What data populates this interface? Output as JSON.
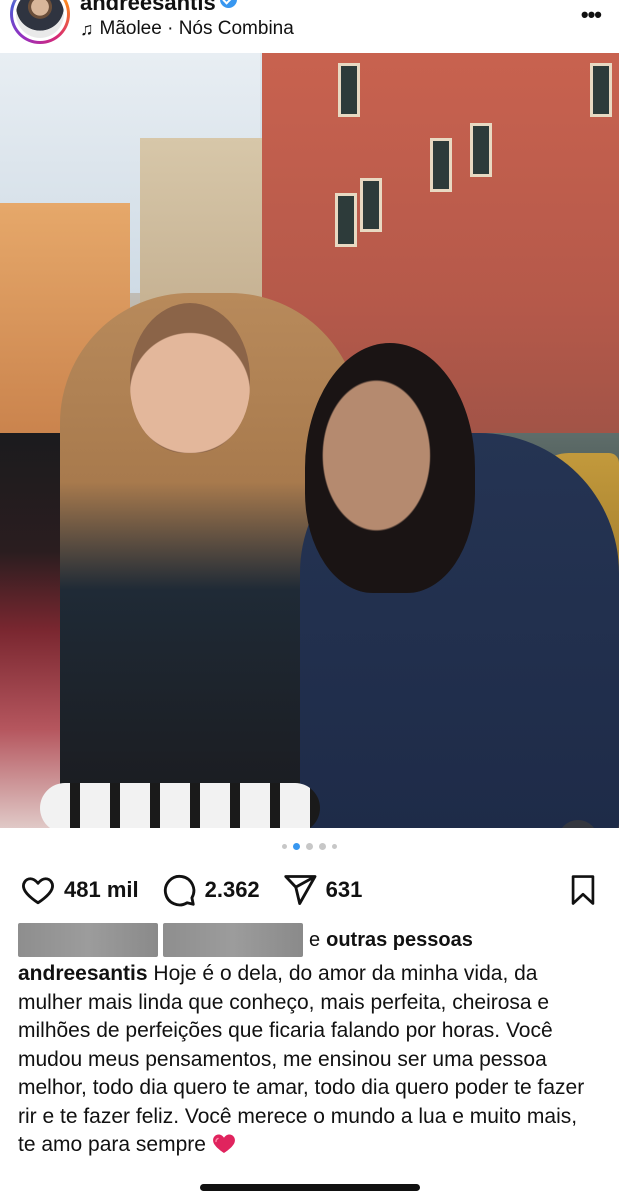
{
  "header": {
    "username": "andreesantis",
    "verified": true,
    "music_label": "Mãolee · Nós Combina",
    "music_icon": "music-note-icon",
    "more_icon": "more-horizontal-icon",
    "more_symbol": "•••"
  },
  "post": {
    "media": {
      "carousel_count": 5,
      "active_index": 1,
      "audio_icon": "speaker-icon"
    },
    "actions": {
      "likes": "481 mil",
      "comments": "2.362",
      "shares": "631"
    },
    "liked_by": {
      "connector": "e",
      "others": "outras pessoas"
    },
    "caption": {
      "username": "andreesantis",
      "text": "Hoje é o dela, do amor da minha vida, da mulher mais linda que conheço, mais perfeita, cheirosa e milhões de perfeições que ficaria falando por horas. Você mudou meus pensamentos, me ensinou ser uma pessoa melhor, todo dia quero te amar, todo dia quero poder te fazer rir e te fazer feliz. Você merece o mundo a lua e muito mais, te amo para sempre",
      "emoji": "red-heart-emoji"
    }
  },
  "colors": {
    "accent": "#3897f0",
    "text": "#111111",
    "heart": "#e0245e"
  }
}
